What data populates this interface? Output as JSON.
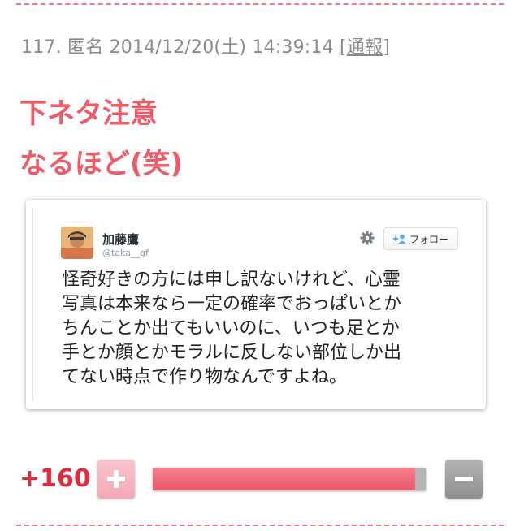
{
  "comment": {
    "number": "117.",
    "author": "匿名",
    "timestamp": "2014/12/20(土) 14:39:14",
    "report_open": "[",
    "report_label": "通報",
    "report_close": "]",
    "lines": [
      "下ネタ注意",
      "なるほど(笑)"
    ]
  },
  "tweet": {
    "display_name": "加藤鷹",
    "handle": "@taka__gf",
    "follow_label": "フォロー",
    "text_lines": [
      "怪奇好きの方には申し訳ないけれど、心霊",
      "写真は本来なら一定の確率でおっぱいとか",
      "ちんことか出てもいいのに、いつも足とか",
      "手とか顔とかモラルに反しない部位しか出",
      "てない時点で作り物なんですよね。"
    ]
  },
  "vote": {
    "score": "+160",
    "plus_ratio": 0.96
  },
  "colors": {
    "accent": "#ef5a67",
    "score": "#e02b3b",
    "meta": "#8a8a8a"
  },
  "icons": {
    "settings": "gear-icon",
    "follow": "add-person-icon",
    "plus": "plus-icon",
    "minus": "minus-icon"
  }
}
